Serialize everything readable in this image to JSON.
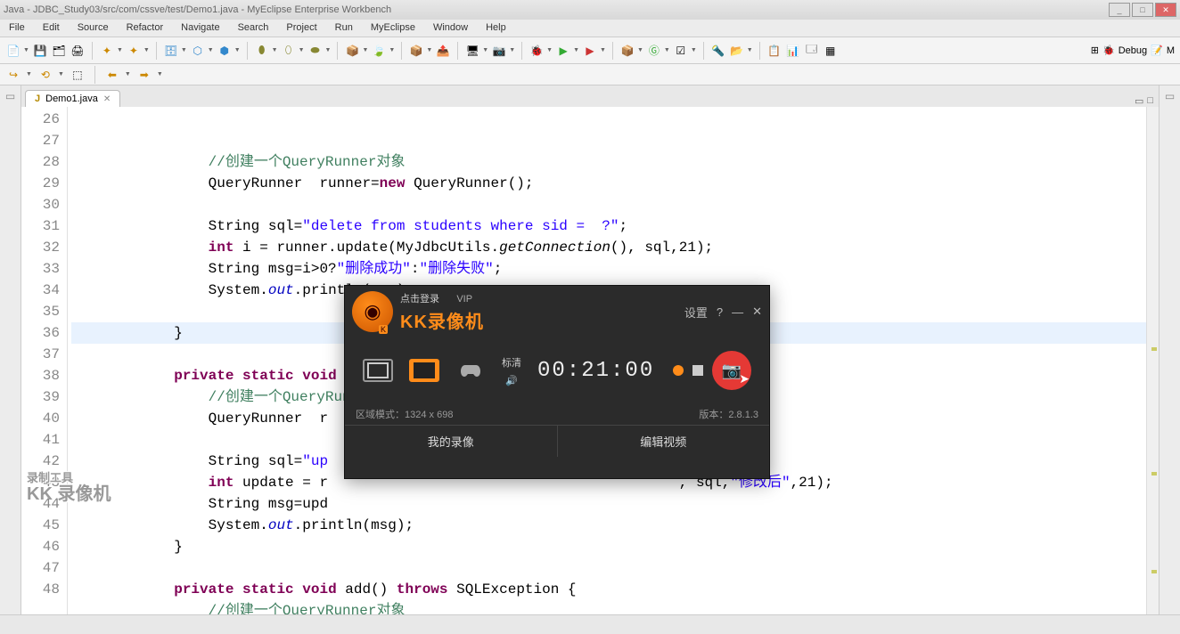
{
  "titlebar": {
    "title": "Java - JDBC_Study03/src/com/cssve/test/Demo1.java - MyEclipse Enterprise Workbench"
  },
  "menu": [
    "File",
    "Edit",
    "Source",
    "Refactor",
    "Navigate",
    "Search",
    "Project",
    "Run",
    "MyEclipse",
    "Window",
    "Help"
  ],
  "debug_label": "Debug",
  "editor": {
    "tab_name": "Demo1.java",
    "lines": {
      "26": "",
      "27_comment": "//创建一个QueryRunner对象",
      "28_a": "QueryRunner  runner=",
      "28_kw": "new",
      "28_b": " QueryRunner();",
      "29": "",
      "30_a": "String sql=",
      "30_s": "\"delete from students where sid =  ?\"",
      "30_b": ";",
      "31_a": "",
      "31_kw": "int",
      "31_b": " i = runner.update(MyJdbcUtils.",
      "31_m": "getConnection",
      "31_c": "(), sql,21);",
      "32_a": "String msg=i>0?",
      "32_s1": "\"删除成功\"",
      "32_b": ":",
      "32_s2": "\"删除失败\"",
      "32_c": ";",
      "33_a": "System.",
      "33_f": "out",
      "33_b": ".println(msg);",
      "34": "",
      "35": "    }",
      "36": "",
      "37_a": "",
      "37_kw1": "private",
      "37_kw2": "static",
      "37_kw3": "void",
      "37_rest": "",
      "38_comment": "//创建一个QueryRunner对象",
      "39": "QueryRunner  r",
      "40": "",
      "41_a": "String sql=",
      "41_s": "\"up",
      "42_kw": "int",
      "42_a": " update = r",
      "42_b": ", sql,",
      "42_s": "\"修改后\"",
      "42_c": ",21);",
      "43_a": "String msg=upd",
      "44_a": "System.",
      "44_f": "out",
      "44_b": ".println(msg);",
      "45": "    }",
      "46": "",
      "47_kw1": "private",
      "47_kw2": "static",
      "47_kw3": "void",
      "47_m": " add() ",
      "47_kw4": "throws",
      "47_b": " SQLException {",
      "48_comment": "//创建一个QueryRunner对象"
    }
  },
  "kk": {
    "login_hint": "点击登录",
    "vip": "VIP",
    "brand": "KK录像机",
    "settings": "设置",
    "quality": "标清",
    "timer": "00:21:00",
    "mode_info": "区域模式：1324 x 698",
    "version": "版本：2.8.1.3",
    "my_recordings": "我的录像",
    "edit_video": "编辑视频"
  },
  "watermark": {
    "l1": "录制工具",
    "l2": "KK 录像机"
  }
}
